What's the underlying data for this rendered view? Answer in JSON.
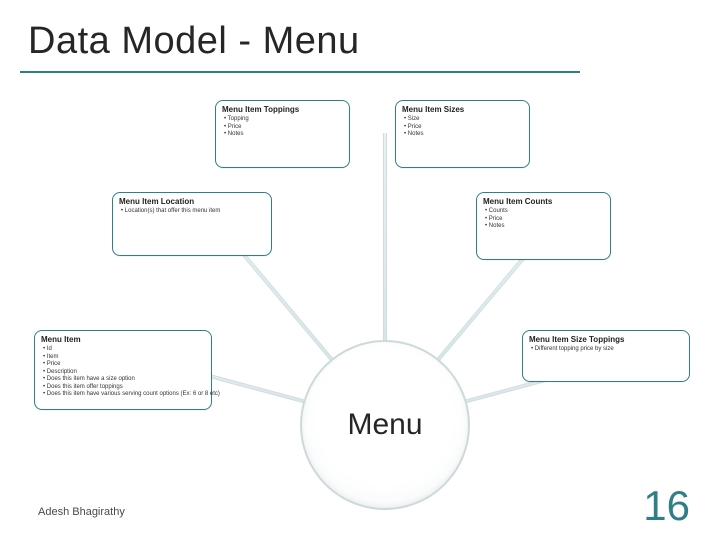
{
  "slide": {
    "title": "Data Model - Menu",
    "center_label": "Menu",
    "author": "Adesh Bhagirathy",
    "page_number": "16"
  },
  "entities": {
    "menu_item_toppings": {
      "title": "Menu Item Toppings",
      "bullets": [
        "Topping",
        "Price",
        "Notes"
      ]
    },
    "menu_item_sizes": {
      "title": "Menu Item Sizes",
      "bullets": [
        "Size",
        "Price",
        "Notes"
      ]
    },
    "menu_item_location": {
      "title": "Menu Item Location",
      "bullets": [
        "Location(s) that offer this menu item"
      ]
    },
    "menu_item_counts": {
      "title": "Menu Item Counts",
      "bullets": [
        "Counts",
        "Price",
        "Notes"
      ]
    },
    "menu_item": {
      "title": "Menu Item",
      "bullets": [
        "Id",
        "Item",
        "Price",
        "Description",
        "Does this item have a size option",
        "Does this item offer toppings",
        "Does this item have various serving count options (Ex: 6 or 8 etc)"
      ]
    },
    "menu_item_size_toppings": {
      "title": "Menu Item Size Toppings",
      "bullets": [
        "Different topping price by size"
      ]
    }
  }
}
